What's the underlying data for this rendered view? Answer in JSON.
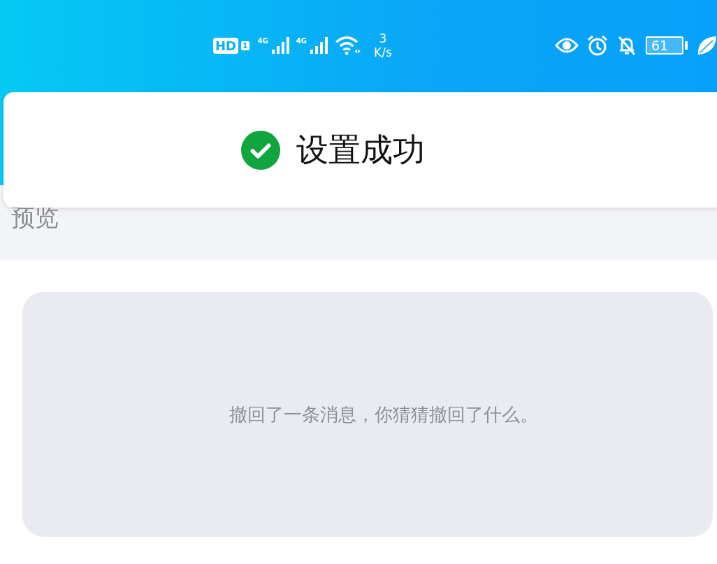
{
  "status_bar": {
    "hd_badge": "HD",
    "sim_slot": "1",
    "networks": [
      {
        "label": "4G"
      },
      {
        "label": "4G"
      }
    ],
    "speed_value": "3",
    "speed_unit": "K/s",
    "battery": "61"
  },
  "toast": {
    "message": "设置成功"
  },
  "section_title": "预览",
  "preview": {
    "message": "撤回了一条消息，你猜猜撤回了什么。"
  }
}
